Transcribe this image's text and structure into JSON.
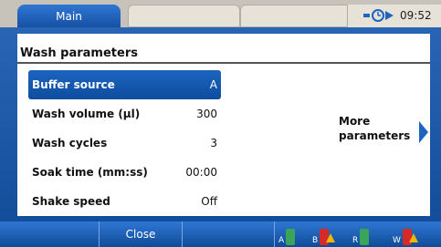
{
  "tabs": [
    {
      "label": "Main"
    },
    {
      "label": ""
    },
    {
      "label": ""
    }
  ],
  "status": {
    "time": "09:52",
    "icon": "network-status-icon"
  },
  "panel": {
    "title": "Wash parameters",
    "rows": [
      {
        "label": "Buffer source",
        "value": "A"
      },
      {
        "label": "Wash volume (µl)",
        "value": "300"
      },
      {
        "label": "Wash cycles",
        "value": "3"
      },
      {
        "label": "Soak time (mm:ss)",
        "value": "00:00"
      },
      {
        "label": "Shake speed",
        "value": "Off"
      }
    ],
    "more": {
      "label": "More parameters"
    }
  },
  "bottom": {
    "close_label": "Close",
    "reservoirs": [
      {
        "label": "A",
        "color": "#3aa55a",
        "warning": false
      },
      {
        "label": "B",
        "color": "#d62a2a",
        "warning": true
      },
      {
        "label": "R",
        "color": "#3aa55a",
        "warning": false
      },
      {
        "label": "W",
        "color": "#d62a2a",
        "warning": true
      }
    ]
  },
  "colors": {
    "accent": "#1751a4",
    "highlight": "#1d63bf",
    "background": "#0f4b97"
  }
}
